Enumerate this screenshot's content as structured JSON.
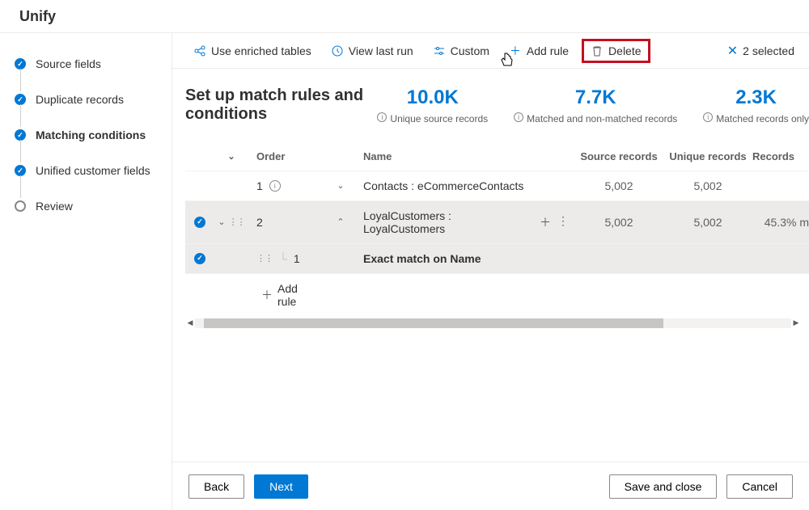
{
  "header": {
    "title": "Unify"
  },
  "sidebar": {
    "steps": [
      {
        "label": "Source fields",
        "state": "done"
      },
      {
        "label": "Duplicate records",
        "state": "done"
      },
      {
        "label": "Matching conditions",
        "state": "done",
        "active": true
      },
      {
        "label": "Unified customer fields",
        "state": "done"
      },
      {
        "label": "Review",
        "state": "pending"
      }
    ]
  },
  "toolbar": {
    "enriched": "Use enriched tables",
    "viewlast": "View last run",
    "custom": "Custom",
    "addrule": "Add rule",
    "delete": "Delete",
    "selected": "2 selected"
  },
  "title": "Set up match rules and conditions",
  "stats": {
    "unique": {
      "val": "10.0K",
      "lbl": "Unique source records"
    },
    "matched": {
      "val": "7.7K",
      "lbl": "Matched and non-matched records"
    },
    "only": {
      "val": "2.3K",
      "lbl": "Matched records only"
    }
  },
  "columns": {
    "order": "Order",
    "name": "Name",
    "source": "Source records",
    "unique": "Unique records",
    "matched": "Records"
  },
  "rows": [
    {
      "order": "1",
      "name": "Contacts : eCommerceContacts",
      "source": "5,002",
      "unique": "5,002",
      "matched": "",
      "selected": false,
      "hasInfo": true,
      "expandIcon": "down"
    },
    {
      "order": "2",
      "name": "LoyalCustomers : LoyalCustomers",
      "source": "5,002",
      "unique": "5,002",
      "matched": "45.3% m",
      "selected": true,
      "hasDrag": true,
      "expandIcon": "up",
      "hasActions": true
    }
  ],
  "subrule": {
    "order": "1",
    "name": "Exact match on Name"
  },
  "addRuleLabel": "Add rule",
  "footer": {
    "back": "Back",
    "next": "Next",
    "save": "Save and close",
    "cancel": "Cancel"
  }
}
